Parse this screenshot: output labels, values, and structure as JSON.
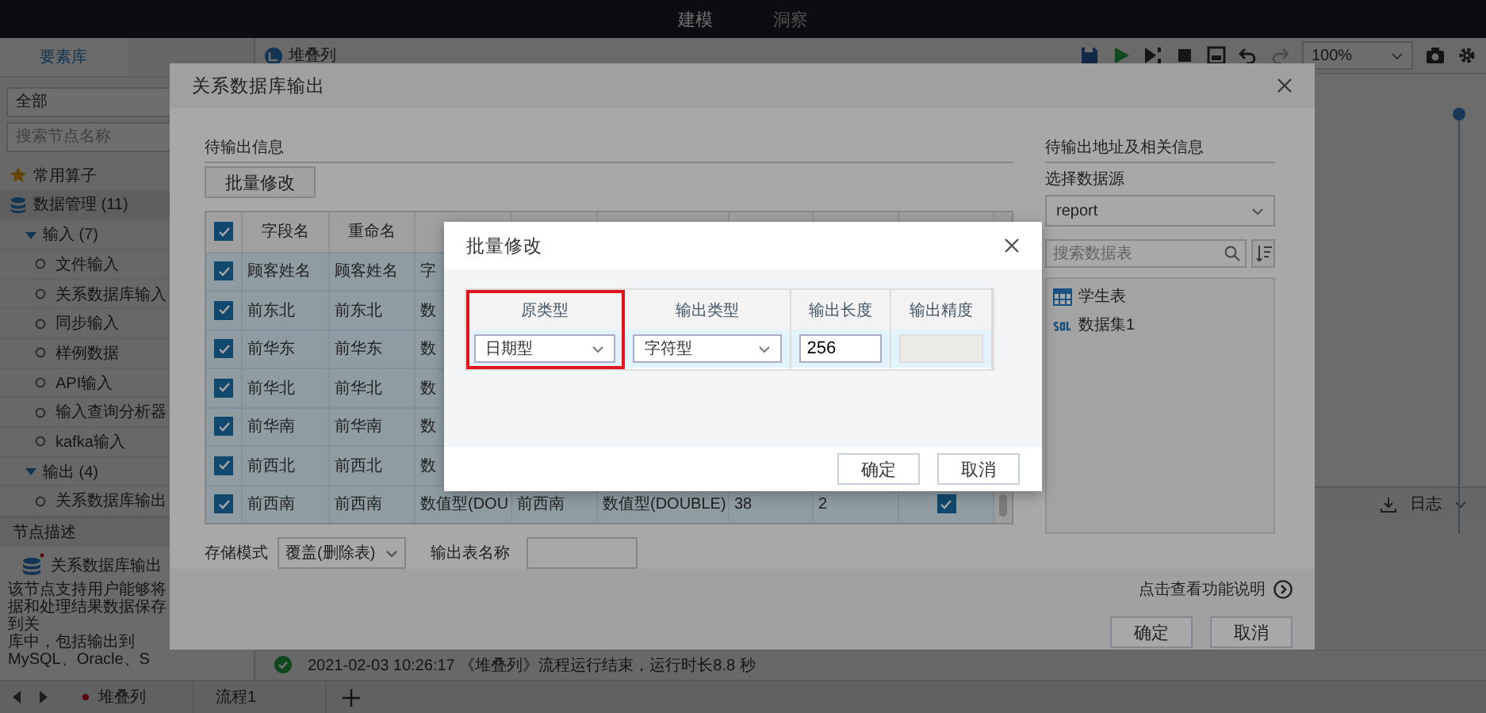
{
  "top_bar": {
    "tabs": [
      {
        "label": "建模",
        "selected": true
      },
      {
        "label": "洞察",
        "selected": false
      }
    ]
  },
  "sidebar": {
    "tabs": [
      {
        "label": "要素库",
        "selected": true
      }
    ],
    "filter": "全部",
    "search": {
      "placeholder": "搜索节点名称"
    },
    "tree": [
      {
        "label": "常用算子",
        "kind": "favorite"
      },
      {
        "label": "数据管理 (11)",
        "kind": "category",
        "children": [
          {
            "label": "输入 (7)",
            "kind": "group",
            "expanded": true,
            "children": [
              {
                "label": "文件输入",
                "kind": "leaf"
              },
              {
                "label": "关系数据库输入",
                "kind": "leaf"
              },
              {
                "label": "同步输入",
                "kind": "leaf"
              },
              {
                "label": "样例数据",
                "kind": "leaf"
              },
              {
                "label": "API输入",
                "kind": "leaf"
              },
              {
                "label": "输入查询分析器",
                "kind": "leaf"
              },
              {
                "label": "kafka输入",
                "kind": "leaf"
              }
            ]
          },
          {
            "label": "输出 (4)",
            "kind": "group",
            "expanded": true,
            "children": [
              {
                "label": "关系数据库输出",
                "kind": "leaf"
              }
            ]
          }
        ]
      }
    ]
  },
  "node_description": {
    "title": "节点描述",
    "node_name": "关系数据库输出",
    "lines": [
      "该节点支持用户能够将",
      "据和处理结果数据保存到关",
      "库中，包括输出到MySQL、Oracle、S"
    ]
  },
  "canvas": {
    "tab": "堆叠列",
    "zoom": "100%"
  },
  "log": {
    "title": "日志",
    "entries": [
      {
        "text": "2021-02-03 10:26:17 《堆叠列》流程运行结束，运行时长8.8 秒"
      }
    ]
  },
  "bottom_tabs": [
    {
      "label": "堆叠列",
      "modified": true
    },
    {
      "label": "流程1",
      "modified": false
    }
  ],
  "dialog": {
    "title": "关系数据库输出",
    "pending": {
      "title": "待输出信息",
      "batch_button": "批量修改",
      "header_checked": true,
      "columns": [
        "字段名",
        "重命名"
      ],
      "rows": [
        {
          "checked": true,
          "cells": [
            "顾客姓名",
            "顾客姓名",
            "字"
          ]
        },
        {
          "checked": true,
          "cells": [
            "前东北",
            "前东北",
            "数"
          ]
        },
        {
          "checked": true,
          "cells": [
            "前华东",
            "前华东",
            "数"
          ]
        },
        {
          "checked": true,
          "cells": [
            "前华北",
            "前华北",
            "数"
          ]
        },
        {
          "checked": true,
          "cells": [
            "前华南",
            "前华南",
            "数"
          ]
        },
        {
          "checked": true,
          "cells": [
            "前西北",
            "前西北",
            "数"
          ]
        },
        {
          "checked": true,
          "cells": [
            "前西南",
            "前西南",
            "数值型(DOU",
            "前西南",
            "数值型(DOUBLE)",
            "38",
            "2"
          ],
          "output_checked": true
        }
      ]
    },
    "storage_mode": {
      "label": "存储模式",
      "value": "覆盖(删除表)"
    },
    "table_name": {
      "label": "输出表名称"
    },
    "target": {
      "title": "待输出地址及相关信息",
      "source_label": "选择数据源",
      "source": "report",
      "search": {
        "placeholder": "搜索数据表"
      },
      "tables": [
        {
          "name": "学生表",
          "kind": "table"
        },
        {
          "name": "数据集1",
          "kind": "sql"
        }
      ]
    },
    "help_link": "点击查看功能说明",
    "buttons": [
      "确定",
      "取消"
    ]
  },
  "batch_dialog": {
    "title": "批量修改",
    "columns": [
      {
        "label": "原类型",
        "highlighted": true
      },
      {
        "label": "输出类型",
        "highlighted": false
      },
      {
        "label": "输出长度",
        "highlighted": false
      },
      {
        "label": "输出精度",
        "highlighted": false
      }
    ],
    "row": {
      "original_type": "日期型",
      "output_type": "字符型",
      "length": "256",
      "precision_disabled": true
    },
    "buttons": [
      "确定",
      "取消"
    ]
  }
}
